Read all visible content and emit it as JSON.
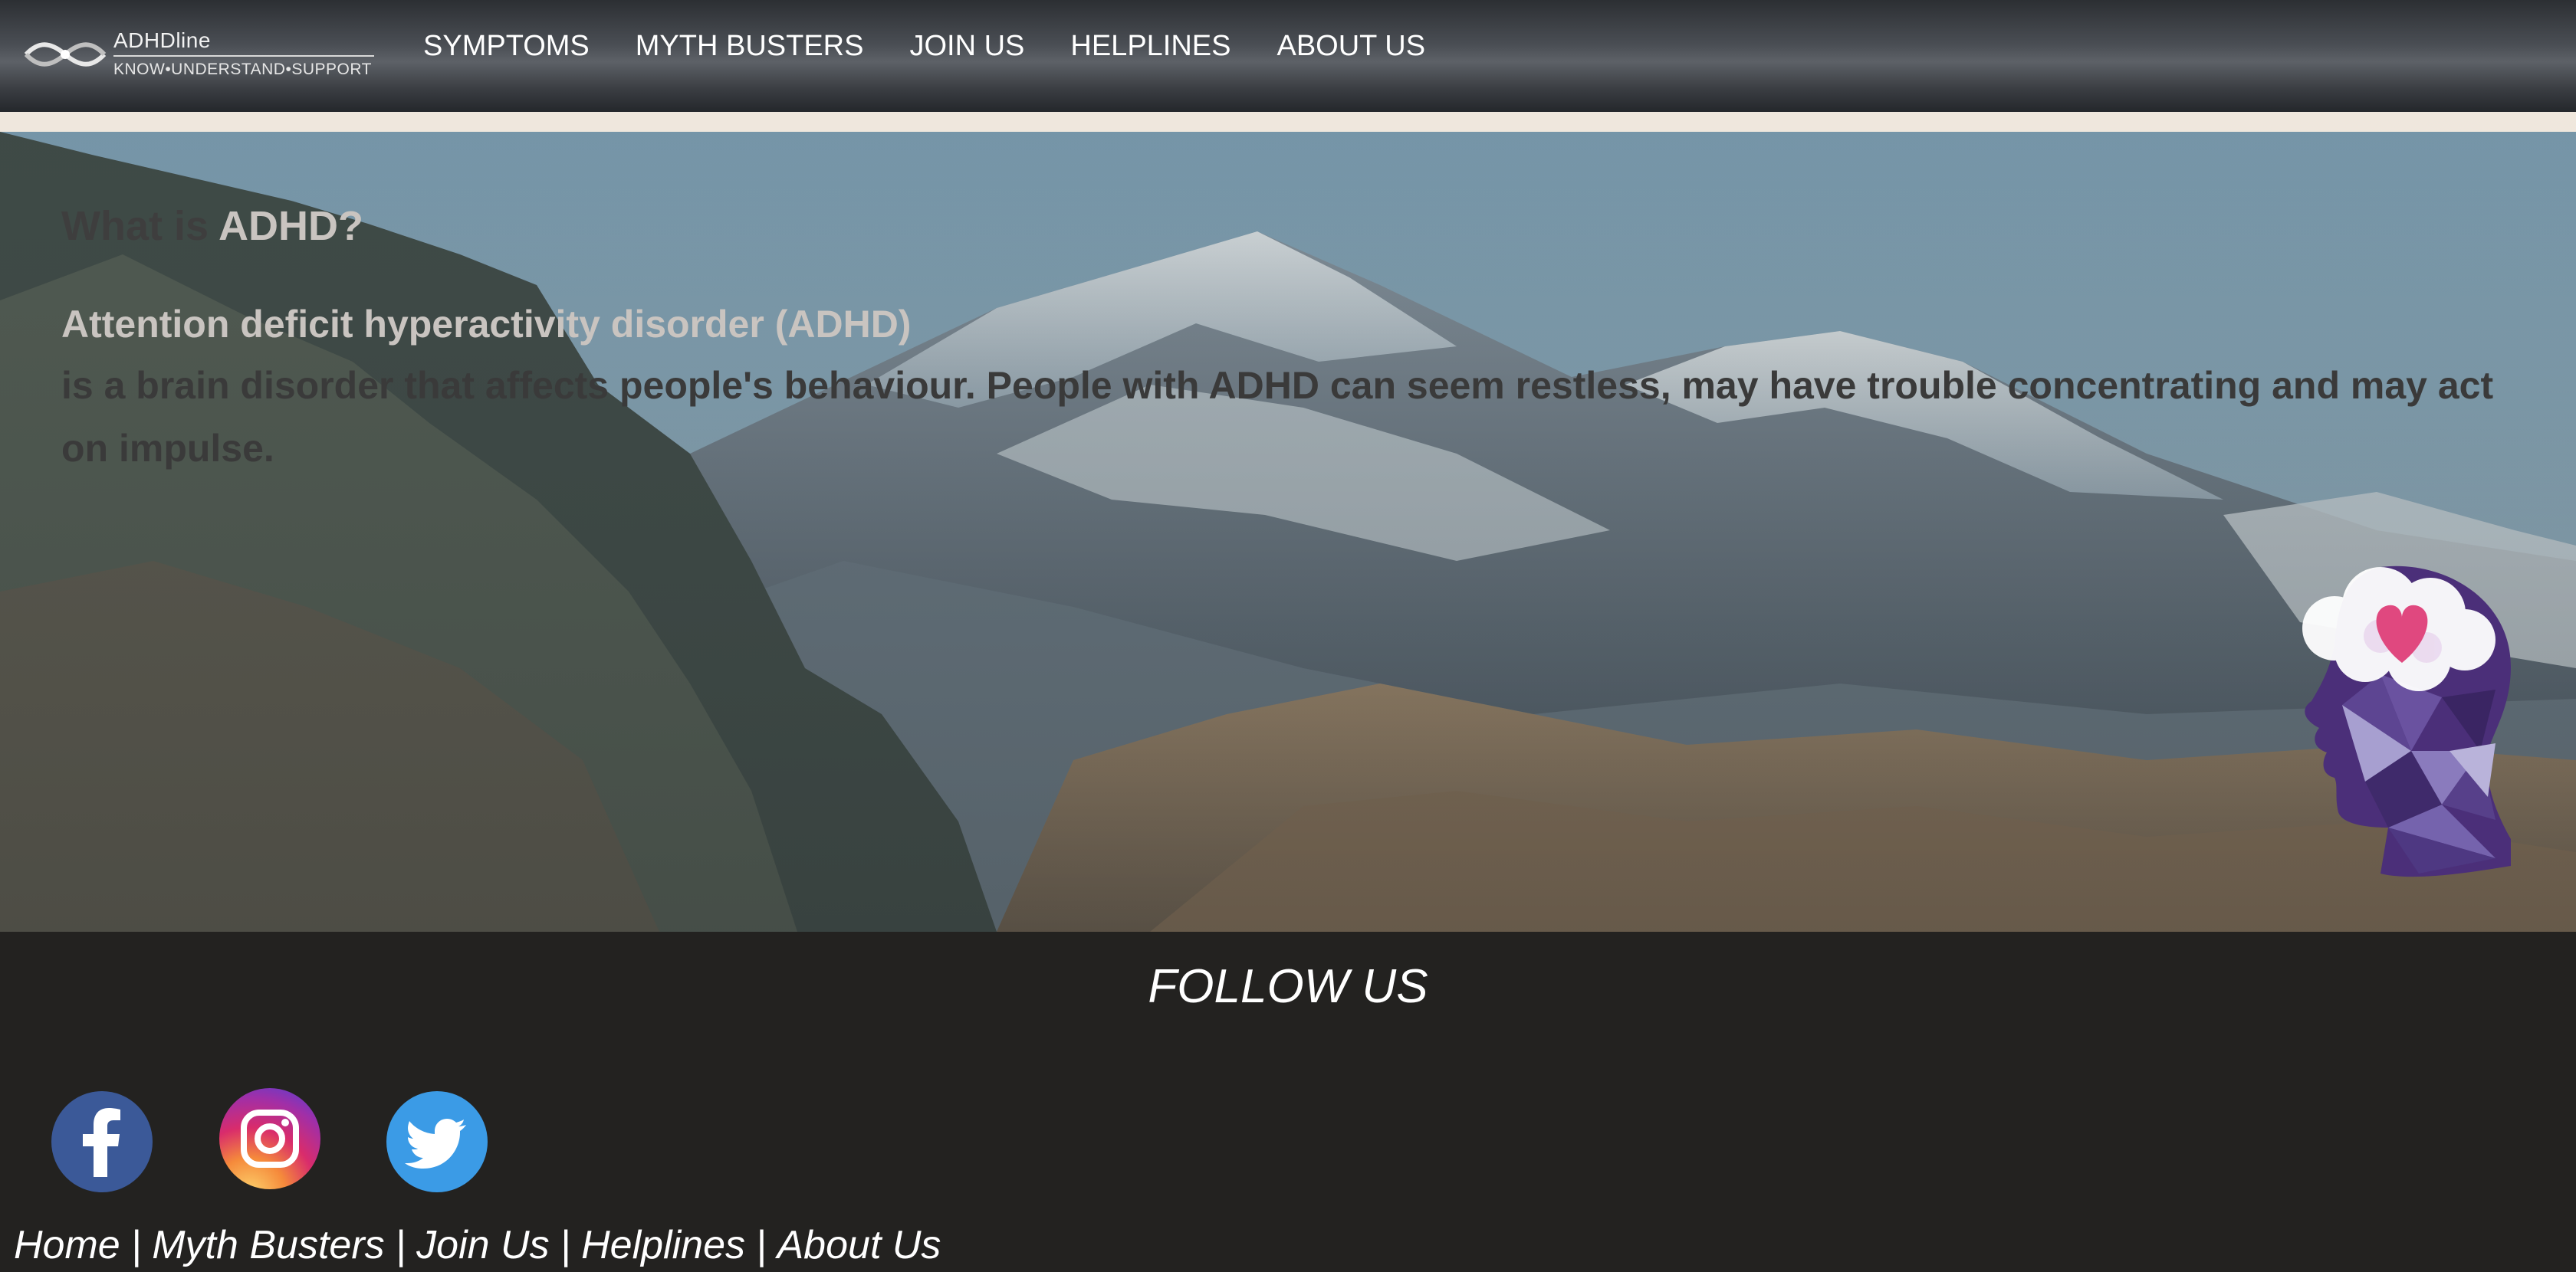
{
  "brand": {
    "name": "ADHDline",
    "tagline": "KNOW•UNDERSTAND•SUPPORT"
  },
  "nav": {
    "items": [
      {
        "label": "SYMPTOMS"
      },
      {
        "label": "MYTH BUSTERS"
      },
      {
        "label": "JOIN US"
      },
      {
        "label": "HELPLINES"
      },
      {
        "label": "ABOUT US"
      }
    ]
  },
  "hero": {
    "title_prefix": "What is ",
    "title_accent": "ADHD?",
    "term": "Attention deficit hyperactivity disorder (ADHD)",
    "description": " is a brain disorder that affects people's behaviour. People with ADHD can seem restless, may have trouble concentrating and may act on impulse."
  },
  "footer": {
    "follow_title": "FOLLOW US",
    "social": [
      {
        "icon": "facebook-icon"
      },
      {
        "icon": "instagram-icon"
      },
      {
        "icon": "twitter-icon"
      }
    ],
    "links": [
      {
        "label": "Home"
      },
      {
        "label": "Myth Busters"
      },
      {
        "label": "Join Us"
      },
      {
        "label": "Helplines"
      },
      {
        "label": "About Us"
      }
    ],
    "separator": "|"
  },
  "colors": {
    "nav_bg": "#4a4e54",
    "cream_strip": "#efe7dd",
    "footer_bg": "#232220",
    "accent_text": "#c9c4c0",
    "body_text": "#3a3a3a",
    "heart": "#e0487f",
    "head_purple": "#4b2f79"
  }
}
